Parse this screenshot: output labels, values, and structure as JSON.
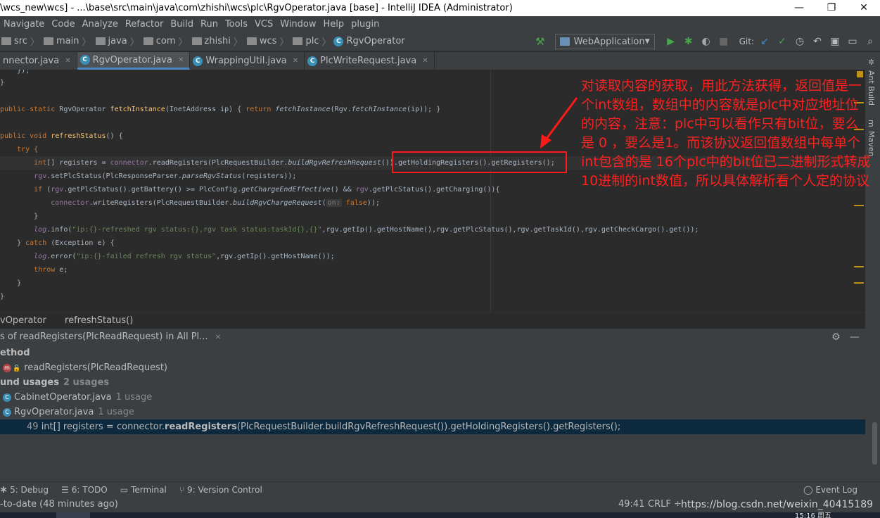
{
  "window": {
    "title": "\\wcs_new\\wcs] - ...\\base\\src\\main\\java\\com\\zhishi\\wcs\\plc\\RgvOperator.java [base] - IntelliJ IDEA (Administrator)",
    "min": "—",
    "max": "❐",
    "close": "✕"
  },
  "menu": [
    "Navigate",
    "Code",
    "Analyze",
    "Refactor",
    "Build",
    "Run",
    "Tools",
    "VCS",
    "Window",
    "Help",
    "plugin"
  ],
  "breadcrumbs": [
    "src",
    "main",
    "java",
    "com",
    "zhishi",
    "wcs",
    "plc"
  ],
  "breadcrumb_class": "RgvOperator",
  "run_config": "WebApplication",
  "git_label": "Git:",
  "tabs": [
    {
      "label": "nnector.java",
      "active": false
    },
    {
      "label": "RgvOperator.java",
      "active": true
    },
    {
      "label": "WrappingUtil.java",
      "active": false
    },
    {
      "label": "PlcWriteRequest.java",
      "active": false
    }
  ],
  "code": {
    "l1": "    });",
    "l2": "}",
    "l4_a": "public static ",
    "l4_b": "RgvOperator ",
    "l4_c": "fetchInstance",
    "l4_d": "(InetAddress ip) { ",
    "l4_e": "return ",
    "l4_f": "fetchInstance",
    "l4_g": "(Rgv.",
    "l4_h": "fetchInstance",
    "l4_i": "(ip)); }",
    "l6_a": "public void ",
    "l6_b": "refreshStatus",
    "l6_c": "() {",
    "l7": "    try {",
    "l8_a": "        int",
    "l8_b": "[] registers = ",
    "l8_c": "connector",
    "l8_d": ".readRegisters(PlcRequestBuilder.",
    "l8_e": "buildRgvRefreshRequest",
    "l8_f": "()).getHoldingRegisters().getRegisters();",
    "l9_a": "        rgv",
    "l9_b": ".setPlcStatus(PlcResponseParser.",
    "l9_c": "parseRgvStatus",
    "l9_d": "(registers));",
    "l10_a": "        if ",
    "l10_b": "(",
    "l10_c": "rgv",
    "l10_d": ".getPlcStatus().getBattery() >= PlcConfig.",
    "l10_e": "getChargeEndEffective",
    "l10_f": "() && ",
    "l10_g": "rgv",
    "l10_h": ".getPlcStatus().getCharging()){",
    "l11_a": "            ",
    "l11_b": "connector",
    "l11_c": ".writeRegisters(PlcRequestBuilder.",
    "l11_d": "buildRgvChargeRequest",
    "l11_e": "(",
    "l11_f": "on:",
    "l11_g": " false",
    "l11_h": "));",
    "l12": "        }",
    "l13_a": "        log",
    "l13_b": ".info(",
    "l13_c": "\"ip:{}-refreshed rgv status:{},rgv task status:taskId{},{}\"",
    "l13_d": ",rgv.getIp().getHostName(),rgv.getPlcStatus(),rgv.getTaskId(),rgv.getCheckCargo().get());",
    "l14_a": "    } ",
    "l14_b": "catch ",
    "l14_c": "(Exception e) {",
    "l15_a": "        log",
    "l15_b": ".error(",
    "l15_c": "\"ip:{}-failed refresh rgv status\"",
    "l15_d": ",rgv.getIp().getHostName());",
    "l16_a": "        throw ",
    "l16_b": "e;",
    "l17": "    }",
    "l18": "}"
  },
  "editor_breadcrumb": [
    "vOperator",
    "refreshStatus()"
  ],
  "find": {
    "header": "s of readRegisters(PlcReadRequest) in All Pl...",
    "method_label": "ethod",
    "method_item": "readRegisters(PlcReadRequest)",
    "usages_label": "und usages",
    "usages_count": "2 usages",
    "file1": "CabinetOperator.java",
    "file1_count": "1 usage",
    "file2": "RgvOperator.java",
    "file2_count": "1 usage",
    "usage_line": "49",
    "usage_a": "int",
    "usage_b": "[] registers = connector.",
    "usage_c": "readRegisters",
    "usage_d": "(PlcRequestBuilder.buildRgvRefreshRequest()).getHoldingRegisters().getRegisters();"
  },
  "side_tools": [
    "Ant Build",
    "Maven"
  ],
  "bottom_tools": [
    {
      "label": "5: Debug",
      "icon": "bug-icon"
    },
    {
      "label": "6: TODO",
      "icon": "todo-icon"
    },
    {
      "label": "Terminal",
      "icon": "terminal-icon"
    },
    {
      "label": "9: Version Control",
      "icon": "vcs-icon"
    }
  ],
  "event_log": "Event Log",
  "status": {
    "left": "-to-date (48 minutes ago)",
    "position": "49:41",
    "line_sep": "CRLF ÷",
    "watermark": "https://blog.csdn.net/weixin_40415189"
  },
  "clock": "15:16 周五",
  "annotation": "对读取内容的获取，用此方法获得，返回值是一个int数组，数组中的内容就是plc中对应地址位的内容，注意：plc中可以看作只有bit位，要么是 0 ，要么是1。而该协议返回值数组中每单个int包含的是 16个plc中的bit位已二进制形式转成10进制的int数值，所以具体解析看个人定的协议",
  "colors": {
    "accent": "#4a88c7",
    "annotation": "#ff2020",
    "background": "#2b2b2b"
  }
}
